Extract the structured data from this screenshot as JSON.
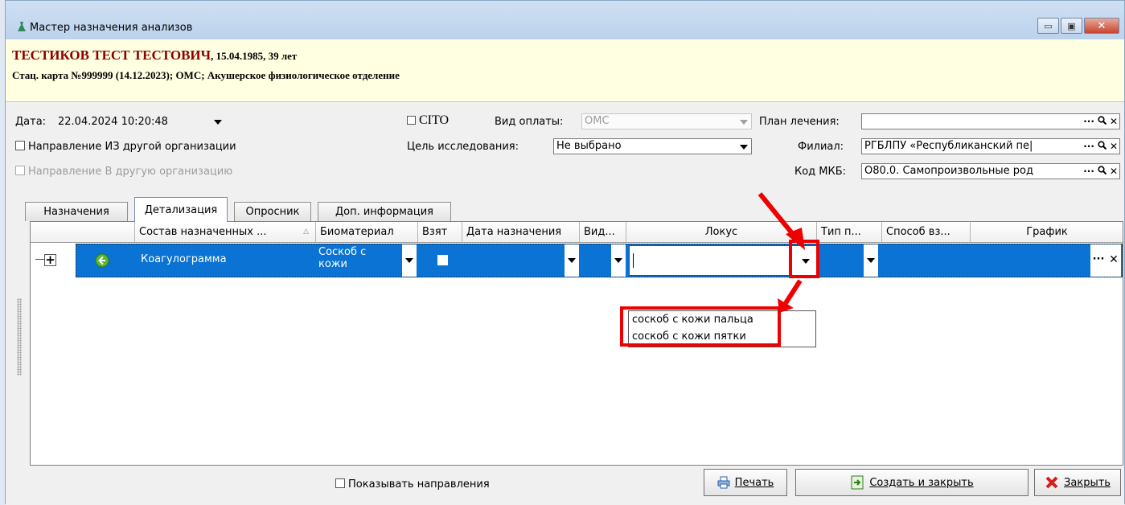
{
  "window": {
    "title": "Мастер назначения анализов",
    "minimize_glyph": "▭",
    "maximize_glyph": "▣",
    "close_glyph": "✕"
  },
  "patient": {
    "name": "ТЕСТИКОВ ТЕСТ ТЕСТОВИЧ",
    "dob_age": ", 15.04.1985, 39 лет",
    "card": "Стац. карта №999999 (14.12.2023); ОМС; Акушерское физиологическое отделение"
  },
  "form": {
    "date_label": "Дата:",
    "date_value": "22.04.2024 10:20:48",
    "cito_label": "CITO",
    "payment_label": "Вид оплаты:",
    "payment_value": "ОМС",
    "plan_label": "План лечения:",
    "plan_value": "",
    "from_org_label": "Направление ИЗ другой организации",
    "purpose_label": "Цель исследования:",
    "purpose_value": "Не выбрано",
    "branch_label": "Филиал:",
    "branch_value": "РГБЛПУ «Республиканский пе|",
    "to_org_label": "Направление В другую организацию",
    "mkb_label": "Код МКБ:",
    "mkb_value": "O80.0. Самопроизвольные род",
    "ellipsis": "···",
    "search_glyph": "🔍",
    "clear_glyph": "✕"
  },
  "tabs": [
    {
      "label": "Назначения"
    },
    {
      "label": "Детализация"
    },
    {
      "label": "Опросник"
    },
    {
      "label": "Доп. информация"
    }
  ],
  "grid": {
    "columns": [
      {
        "label": ""
      },
      {
        "label": "Состав назначенных ..."
      },
      {
        "label": "Биоматериал"
      },
      {
        "label": "Взят"
      },
      {
        "label": "Дата назначения"
      },
      {
        "label": "Вид..."
      },
      {
        "label": "Локус"
      },
      {
        "label": "Тип п..."
      },
      {
        "label": "Способ вз..."
      },
      {
        "label": "График"
      }
    ],
    "row": {
      "name": "Коагулограмма",
      "biomaterial": "Соскоб с кожи",
      "expand_glyph": "+"
    },
    "locus_options": [
      "соскоб с кожи пальца",
      "соскоб с кожи пятки"
    ]
  },
  "footer": {
    "show_directions_label": "Показывать направления",
    "print_label": "Печать",
    "create_close_label": "Создать и закрыть",
    "close_label": "Закрыть"
  }
}
